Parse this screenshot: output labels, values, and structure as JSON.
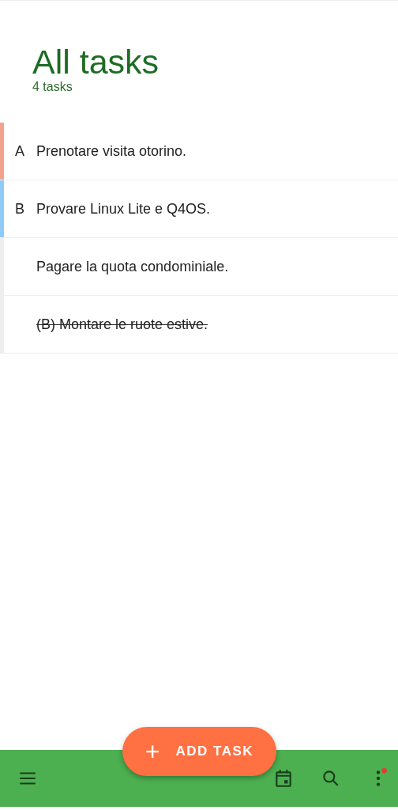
{
  "header": {
    "title": "All tasks",
    "count": "4 tasks"
  },
  "tasks": [
    {
      "priority": "A",
      "text": "Prenotare visita otorino.",
      "completed": false,
      "color": "#f4a28c"
    },
    {
      "priority": "B",
      "text": "Provare Linux Lite e Q4OS.",
      "completed": false,
      "color": "#90caf9"
    },
    {
      "text": "Pagare la quota condominiale.",
      "completed": false,
      "color": "#eeeeee"
    },
    {
      "text": "(B) Montare le ruote estive.",
      "completed": true,
      "color": "#eeeeee"
    }
  ],
  "fab": {
    "icon": "+",
    "label": "ADD TASK"
  },
  "bottom_bar": {
    "more_notification": true
  }
}
